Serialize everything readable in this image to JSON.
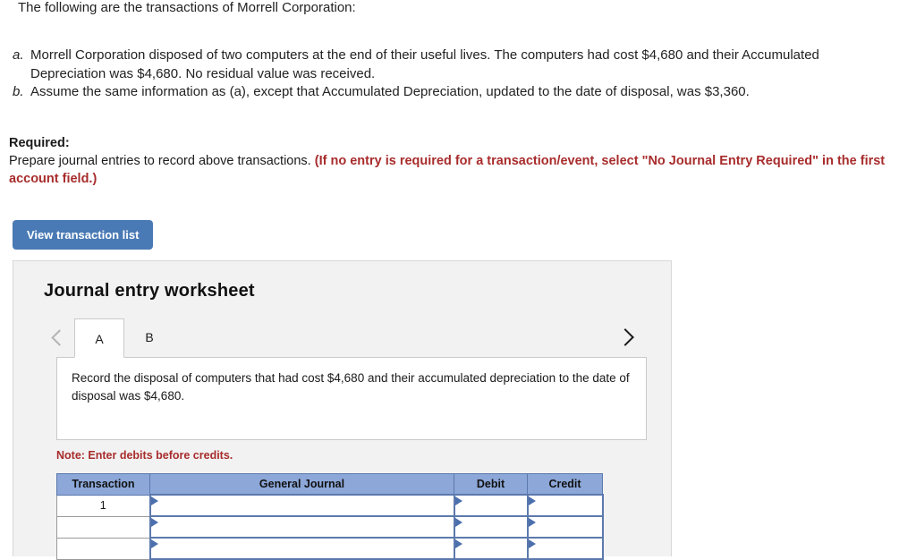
{
  "intro": {
    "text": "The following are the transactions of Morrell Corporation:"
  },
  "problems": [
    {
      "marker": "a.",
      "text": "Morrell Corporation disposed of two computers at the end of their useful lives. The computers had cost $4,680 and their Accumulated Depreciation was $4,680. No residual value was received."
    },
    {
      "marker": "b.",
      "text": "Assume the same information as (a), except that Accumulated Depreciation, updated to the date of disposal, was $3,360."
    }
  ],
  "required": {
    "label": "Required:",
    "body_plain": "Prepare journal entries to record above transactions.",
    "body_emphasis": "(If no entry is required for a transaction/event, select \"No Journal Entry Required\" in the first account field.)",
    "emphasis_color": "#a82c2c"
  },
  "buttons": {
    "view_transaction_list": "View transaction list",
    "view_transaction_list_color": "#4a7ab5"
  },
  "worksheet": {
    "title": "Journal entry worksheet",
    "prev_icon": "chevron-left-icon",
    "next_icon": "chevron-right-icon",
    "tabs": [
      {
        "label": "A",
        "active": true
      },
      {
        "label": "B",
        "active": false
      }
    ],
    "description": "Record the disposal of computers that had cost $4,680 and their accumulated depreciation to the date of disposal was $4,680.",
    "note": "Note: Enter debits before credits.",
    "table": {
      "headers": [
        "Transaction",
        "General Journal",
        "Debit",
        "Credit"
      ],
      "header_color": "#8ca7d8",
      "rows": [
        {
          "transaction": "1",
          "general_journal": "",
          "debit": "",
          "credit": ""
        },
        {
          "transaction": "",
          "general_journal": "",
          "debit": "",
          "credit": ""
        },
        {
          "transaction": "",
          "general_journal": "",
          "debit": "",
          "credit": ""
        }
      ]
    }
  }
}
